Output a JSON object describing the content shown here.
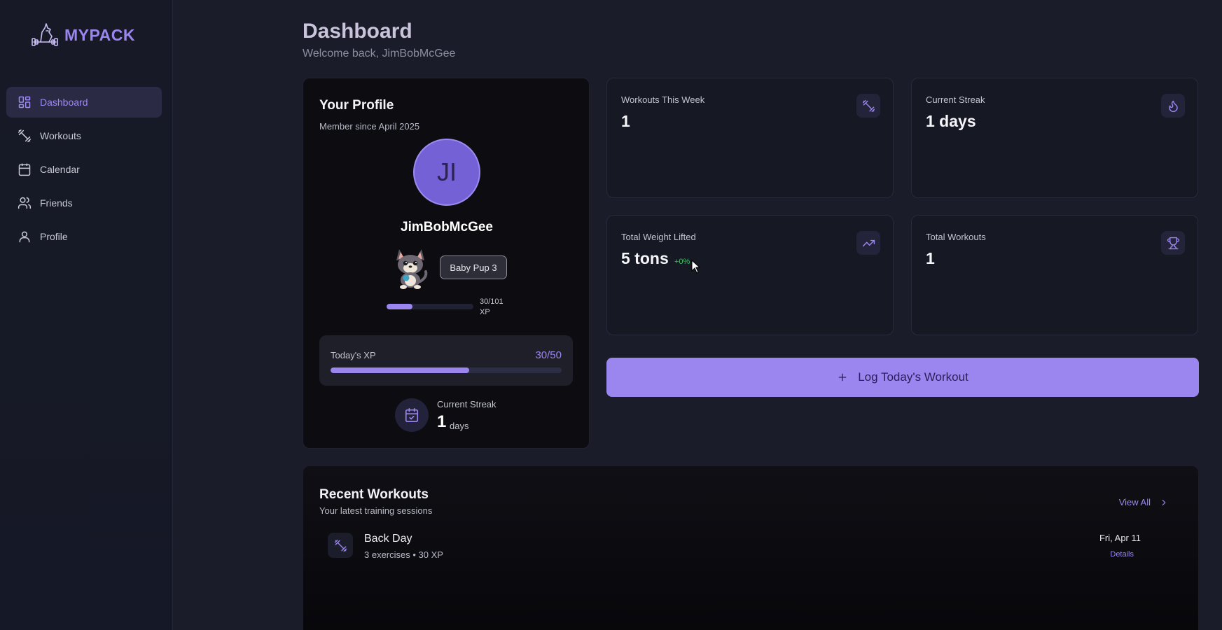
{
  "brand": {
    "name": "MYPACK"
  },
  "sidebar": {
    "items": [
      {
        "label": "Dashboard",
        "icon": "dashboard-icon",
        "active": true
      },
      {
        "label": "Workouts",
        "icon": "dumbbell-icon",
        "active": false
      },
      {
        "label": "Calendar",
        "icon": "calendar-icon",
        "active": false
      },
      {
        "label": "Friends",
        "icon": "users-icon",
        "active": false
      },
      {
        "label": "Profile",
        "icon": "user-icon",
        "active": false
      }
    ]
  },
  "header": {
    "title": "Dashboard",
    "subtitle": "Welcome back, JimBobMcGee"
  },
  "profile": {
    "title": "Your Profile",
    "member_since": "Member since April 2025",
    "avatar_initials": "JI",
    "username": "JimBobMcGee",
    "level_badge": "Baby Pup 3",
    "xp_current": 30,
    "xp_max": 101,
    "xp_text": "30/101 XP",
    "today_xp_label": "Today's XP",
    "today_xp_value": "30/50",
    "today_xp_progress": 0.6,
    "streak_label": "Current Streak",
    "streak_value": "1",
    "streak_unit": "days"
  },
  "stats": [
    {
      "label": "Workouts This Week",
      "value": "1",
      "icon": "dumbbell-icon"
    },
    {
      "label": "Current Streak",
      "value": "1 days",
      "icon": "flame-icon"
    },
    {
      "label": "Total Weight Lifted",
      "value": "5 tons",
      "change": "+0%",
      "icon": "trending-up-icon"
    },
    {
      "label": "Total Workouts",
      "value": "1",
      "icon": "trophy-icon"
    }
  ],
  "log_button": {
    "label": "Log Today's Workout",
    "icon": "plus-icon"
  },
  "recent": {
    "title": "Recent Workouts",
    "subtitle": "Your latest training sessions",
    "view_all": "View All",
    "items": [
      {
        "name": "Back Day",
        "meta": "3 exercises • 30 XP",
        "date": "Fri, Apr 11",
        "details": "Details"
      }
    ]
  },
  "colors": {
    "accent": "#9b86f0",
    "background": "#1a1d29",
    "card": "#161824",
    "positive": "#45c26a"
  }
}
